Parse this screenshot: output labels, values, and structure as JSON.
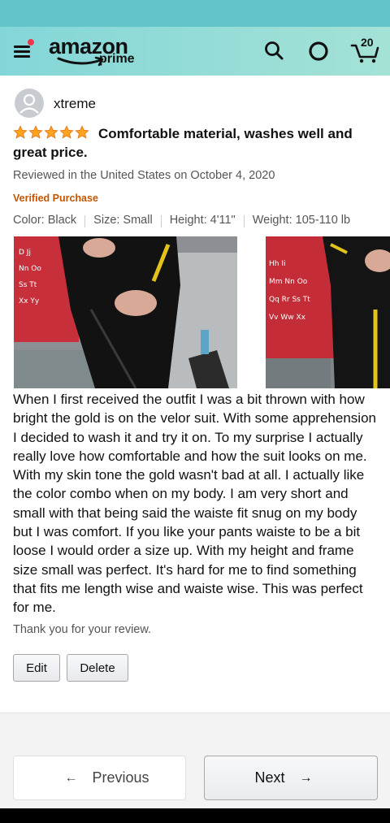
{
  "header": {
    "logo_word": "amazon",
    "logo_sub": "prime",
    "cart_count": "20",
    "icons": [
      "menu-icon",
      "search-icon",
      "alexa-icon",
      "cart-icon"
    ]
  },
  "review": {
    "username": "xtreme",
    "rating": 5,
    "title": "Comfortable material, washes well and great price.",
    "reviewed_in": "Reviewed in the United States on October 4, 2020",
    "verified": "Verified Purchase",
    "attributes": [
      "Color: Black",
      "Size: Small",
      "Height: 4'11\"",
      "Weight: 105-110 lb"
    ],
    "body": "When I first received the outfit I was a bit thrown with how bright the gold is on the velor suit. With some apprehension I decided to wash it and try it on. To my surprise I actually really love how comfortable and how the suit looks on me. With my skin tone the gold wasn't bad at all. I actually like the color combo when on my body. I am very short and small with that being said the waiste fit snug on my body but I was comfort. If you like your pants waiste to be a bit loose I would order a size up. With my height and frame size small was perfect. It's hard for me to find something that fits me length wise and waiste wise. This was perfect for me.",
    "thanks": "Thank you for your review.",
    "edit_label": "Edit",
    "delete_label": "Delete"
  },
  "pager": {
    "previous_label": "Previous",
    "next_label": "Next",
    "prev_arrow": "←",
    "next_arrow": "→"
  },
  "colors": {
    "header_start": "#83d6d8",
    "header_end": "#a4e2d6",
    "star": "#ffa41c",
    "verified": "#c45500",
    "menu_badge": "#e8374f"
  }
}
